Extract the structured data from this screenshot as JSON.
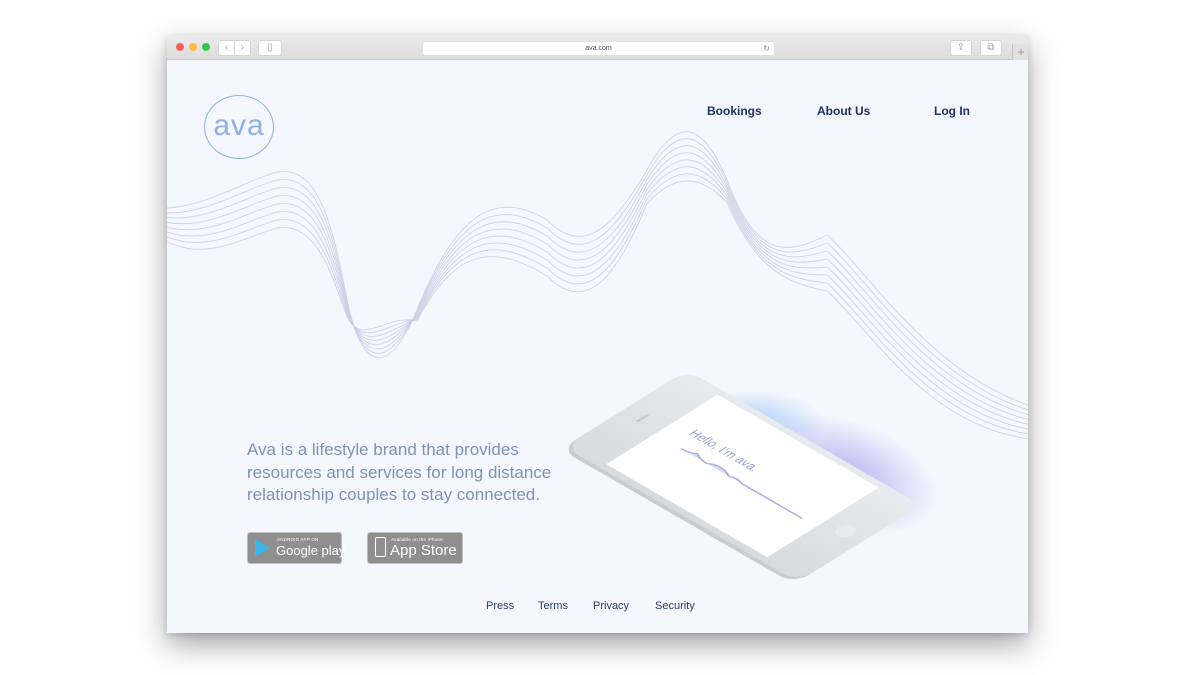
{
  "browser": {
    "url": "ava.com",
    "buttons": {
      "back": "‹",
      "forward": "›",
      "sidebar": "▯",
      "reload": "↻",
      "share": "⇪",
      "tabs": "⧉",
      "new_tab": "+"
    }
  },
  "header": {
    "logo_text": "ava",
    "nav": [
      "Bookings",
      "About Us",
      "Log In"
    ]
  },
  "hero": {
    "tagline": "Ava is a lifestyle brand that provides resources and services for long distance relationship couples to stay connected.",
    "phone_screen_text": "Hello, I'm ava."
  },
  "stores": {
    "google": {
      "small": "ANDROID APP ON",
      "big": "Google play"
    },
    "apple": {
      "small": "Available on the iPhone",
      "big": "App Store"
    }
  },
  "footer": {
    "links": [
      "Press",
      "Terms",
      "Privacy",
      "Security"
    ]
  },
  "colors": {
    "page_bg": "#f4f7fd",
    "nav_text": "#1e2f63",
    "logo": "#8fb0e6",
    "tagline": "#7e92b8",
    "wave_lines": "#c5cbe0"
  }
}
